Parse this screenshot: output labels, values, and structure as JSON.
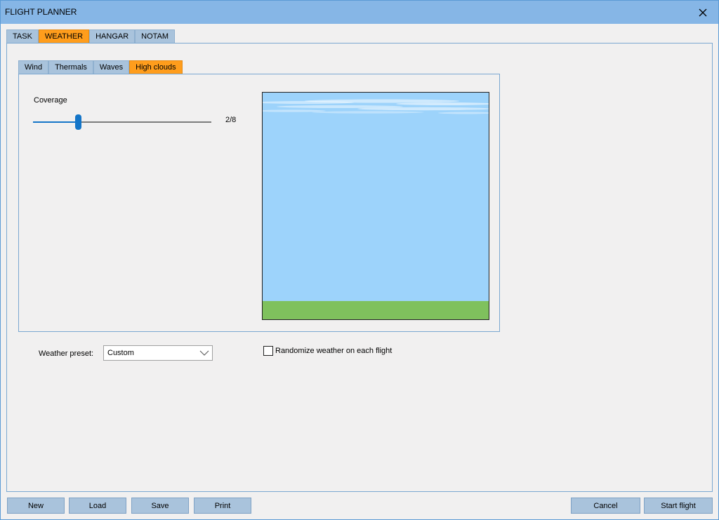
{
  "window": {
    "title": "FLIGHT PLANNER"
  },
  "icons": {
    "close": "close-icon",
    "chevron": "chevron-down-icon"
  },
  "main_tabs": [
    {
      "label": "TASK",
      "active": false
    },
    {
      "label": "WEATHER",
      "active": true
    },
    {
      "label": "HANGAR",
      "active": false
    },
    {
      "label": "NOTAM",
      "active": false
    }
  ],
  "sub_tabs": [
    {
      "label": "Wind",
      "active": false
    },
    {
      "label": "Thermals",
      "active": false
    },
    {
      "label": "Waves",
      "active": false
    },
    {
      "label": "High clouds",
      "active": true
    }
  ],
  "high_clouds": {
    "coverage_label": "Coverage",
    "coverage_value": "2/8",
    "coverage_fraction": 0.25
  },
  "weather_preset": {
    "label": "Weather preset:",
    "value": "Custom"
  },
  "randomize": {
    "label": "Randomize weather on each flight",
    "checked": false
  },
  "buttons": {
    "new": "New",
    "load": "Load",
    "save": "Save",
    "print": "Print",
    "cancel": "Cancel",
    "start": "Start flight"
  },
  "colors": {
    "accent_active_tab": "#ff9d1c",
    "tab_inactive": "#a9c3dc",
    "titlebar": "#86b6e6",
    "slider": "#1475c8",
    "sky": "#9dd3fb",
    "ground": "#7fc15d"
  }
}
